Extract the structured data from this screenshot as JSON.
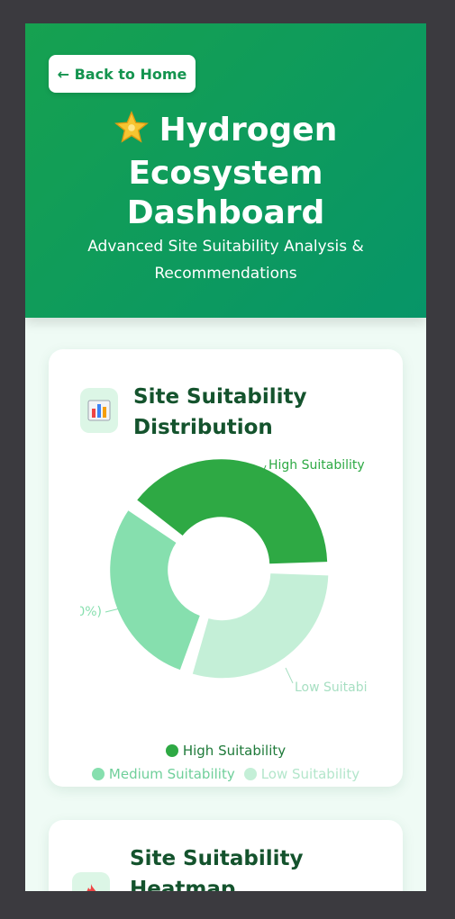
{
  "header": {
    "back_label": "← Back to Home",
    "title_line1": "Hydrogen",
    "title_line2": "Ecosystem",
    "title_line3": "Dashboard",
    "subtitle_line1": "Advanced Site Suitability Analysis &",
    "subtitle_line2": "Recommendations"
  },
  "cards": {
    "distribution": {
      "title_line1": "Site Suitability",
      "title_line2": "Distribution",
      "icon": "bar-chart-icon"
    },
    "heatmap": {
      "title_line1": "Site Suitability",
      "title_line2": "Heatmap",
      "icon": "fire-icon"
    }
  },
  "chart_data": {
    "type": "pie",
    "donut": true,
    "categories": [
      "High Suitability",
      "Medium Suitability",
      "Low Suitability"
    ],
    "values": [
      40,
      30,
      30
    ],
    "colors": [
      "#2ea944",
      "#86dfae",
      "#c4efd7"
    ],
    "labels": {
      "high": "High Suitability",
      "medium": "0%)",
      "low": "Low Suitabi"
    },
    "legend": {
      "placement": "bottom",
      "items": [
        "High Suitability",
        "Medium Suitability",
        "Low Suitability"
      ]
    }
  }
}
